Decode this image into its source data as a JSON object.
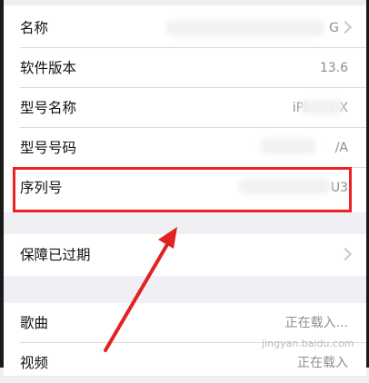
{
  "about": {
    "rows_top": [
      {
        "label": "名称",
        "value": "G",
        "has_chevron": true
      },
      {
        "label": "软件版本",
        "value": "13.6",
        "has_chevron": false
      },
      {
        "label": "型号名称",
        "value": "iPhone X",
        "has_chevron": false
      },
      {
        "label": "型号号码",
        "value": "/A",
        "has_chevron": false
      },
      {
        "label": "序列号",
        "value": "U3",
        "has_chevron": false
      }
    ],
    "warranty": {
      "label": "保障已过期",
      "has_chevron": true
    },
    "media": [
      {
        "label": "歌曲",
        "value": "正在载入..."
      },
      {
        "label": "视频",
        "value": "正在载入"
      }
    ]
  },
  "annotation": {
    "color": "#e22222"
  },
  "watermark": {
    "text": "jingyan.baidu.com"
  }
}
